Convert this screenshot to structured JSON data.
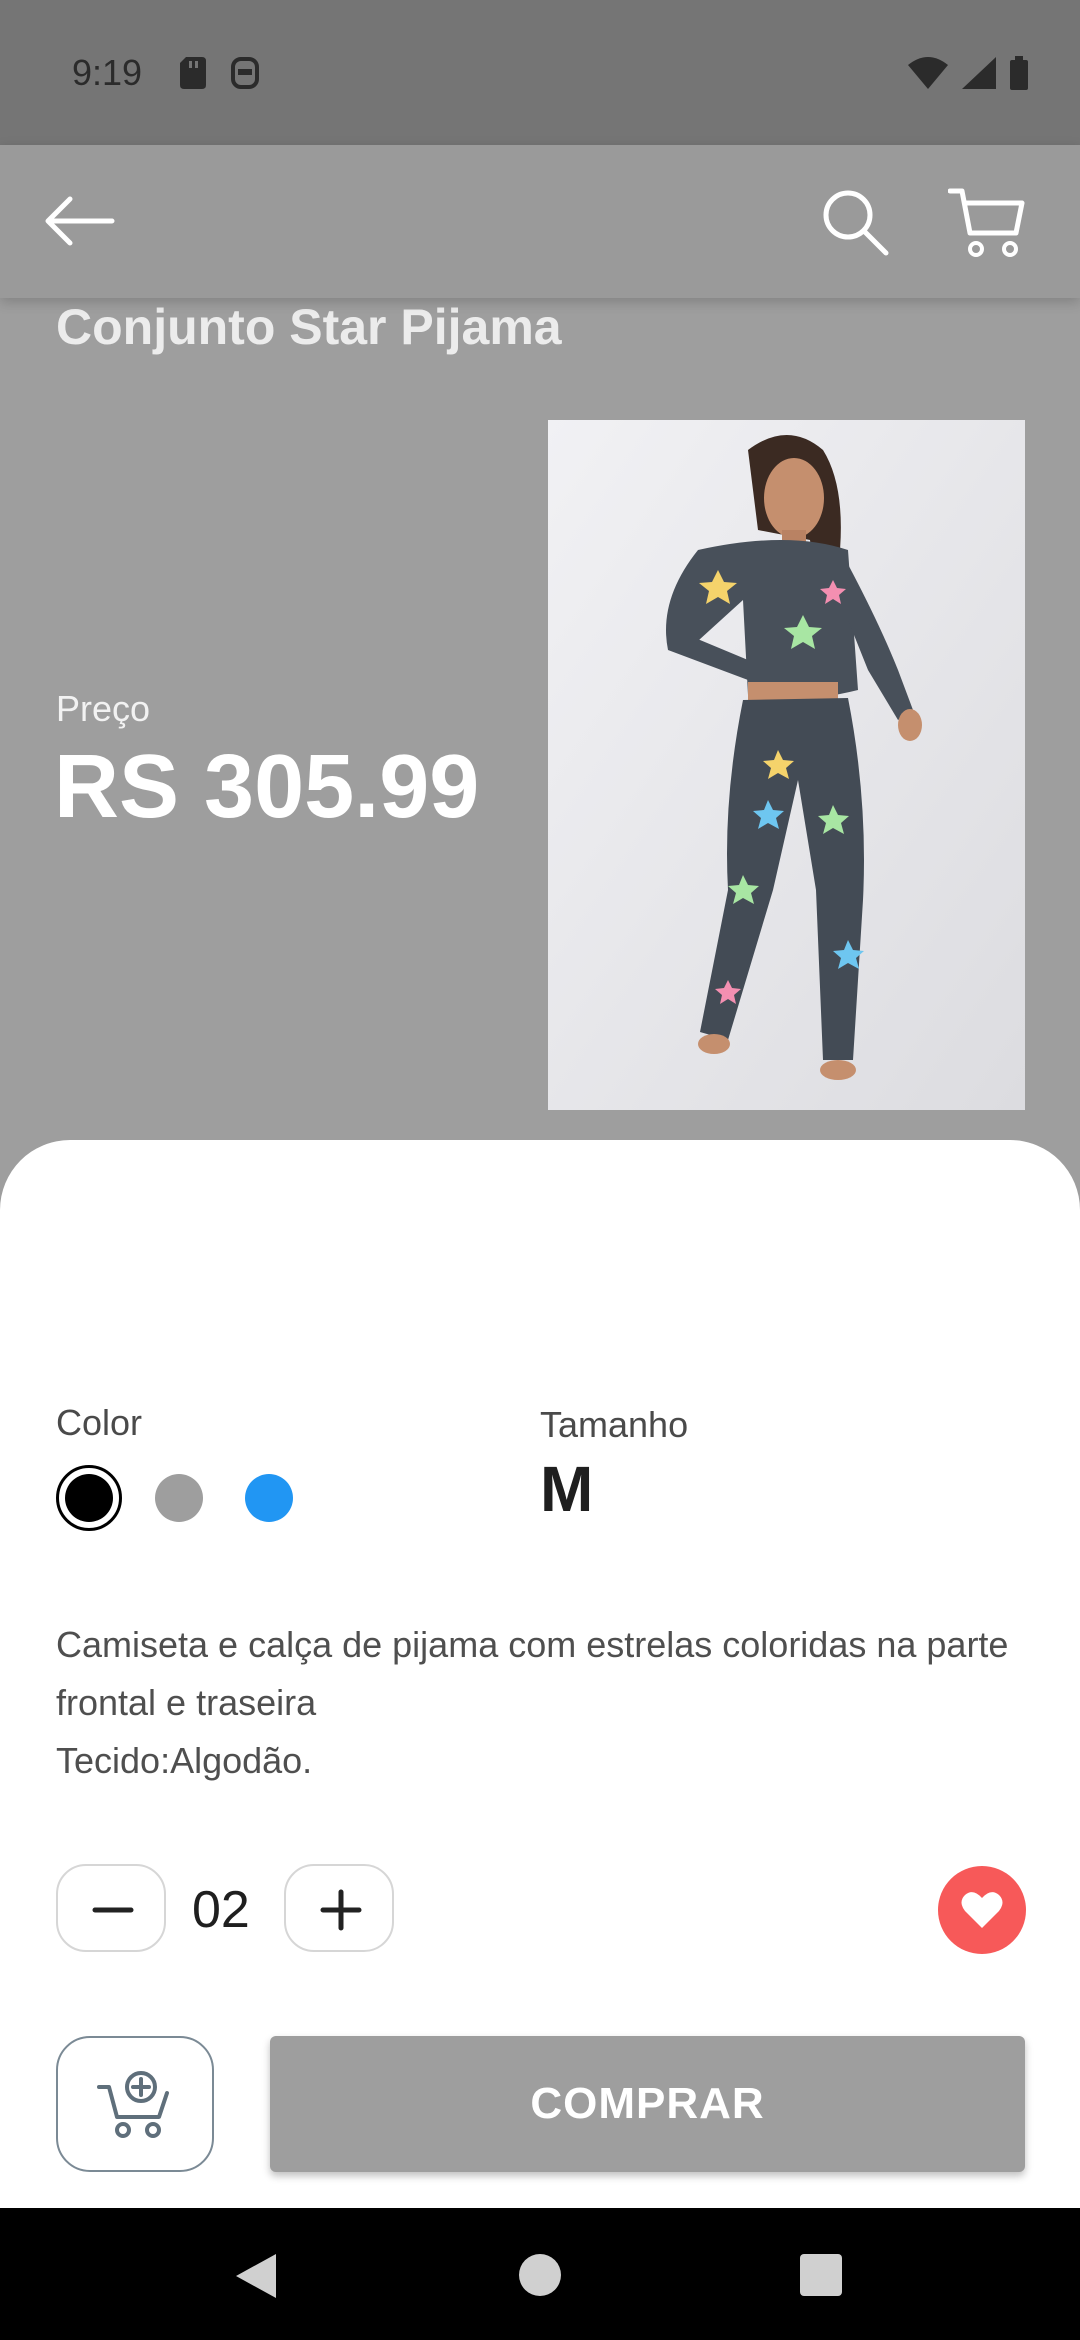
{
  "status_bar": {
    "time": "9:19",
    "left_icons": [
      "sd-card-icon",
      "assistant-icon"
    ],
    "right_icons": [
      "wifi-icon",
      "signal-icon",
      "battery-icon"
    ]
  },
  "app_bar": {
    "icons": [
      "back-arrow-icon",
      "search-icon",
      "cart-icon"
    ]
  },
  "product": {
    "title": "Conjunto Star Pijama",
    "price_label": "Preço",
    "price": "RS 305.99",
    "image": "pajama-model-photo"
  },
  "details": {
    "color_label": "Color",
    "colors": [
      "#000000",
      "#9e9e9e",
      "#2196f3"
    ],
    "selected_color": "#000000",
    "size_label": "Tamanho",
    "size_value": "M",
    "description_line1": "Camiseta e calça de pijama com estrelas coloridas na parte frontal e traseira",
    "description_line2": "Tecido:Algodão."
  },
  "quantity": {
    "value": "02",
    "minus_icon": "minus-icon",
    "plus_icon": "plus-icon"
  },
  "actions": {
    "favorite_icon": "heart-icon",
    "favorite_color": "#f75959",
    "add_to_cart_icon": "cart-plus-icon",
    "buy_label": "COMPRAR"
  },
  "nav_bar": {
    "icons": [
      "nav-back-icon",
      "nav-home-icon",
      "nav-recents-icon"
    ]
  }
}
